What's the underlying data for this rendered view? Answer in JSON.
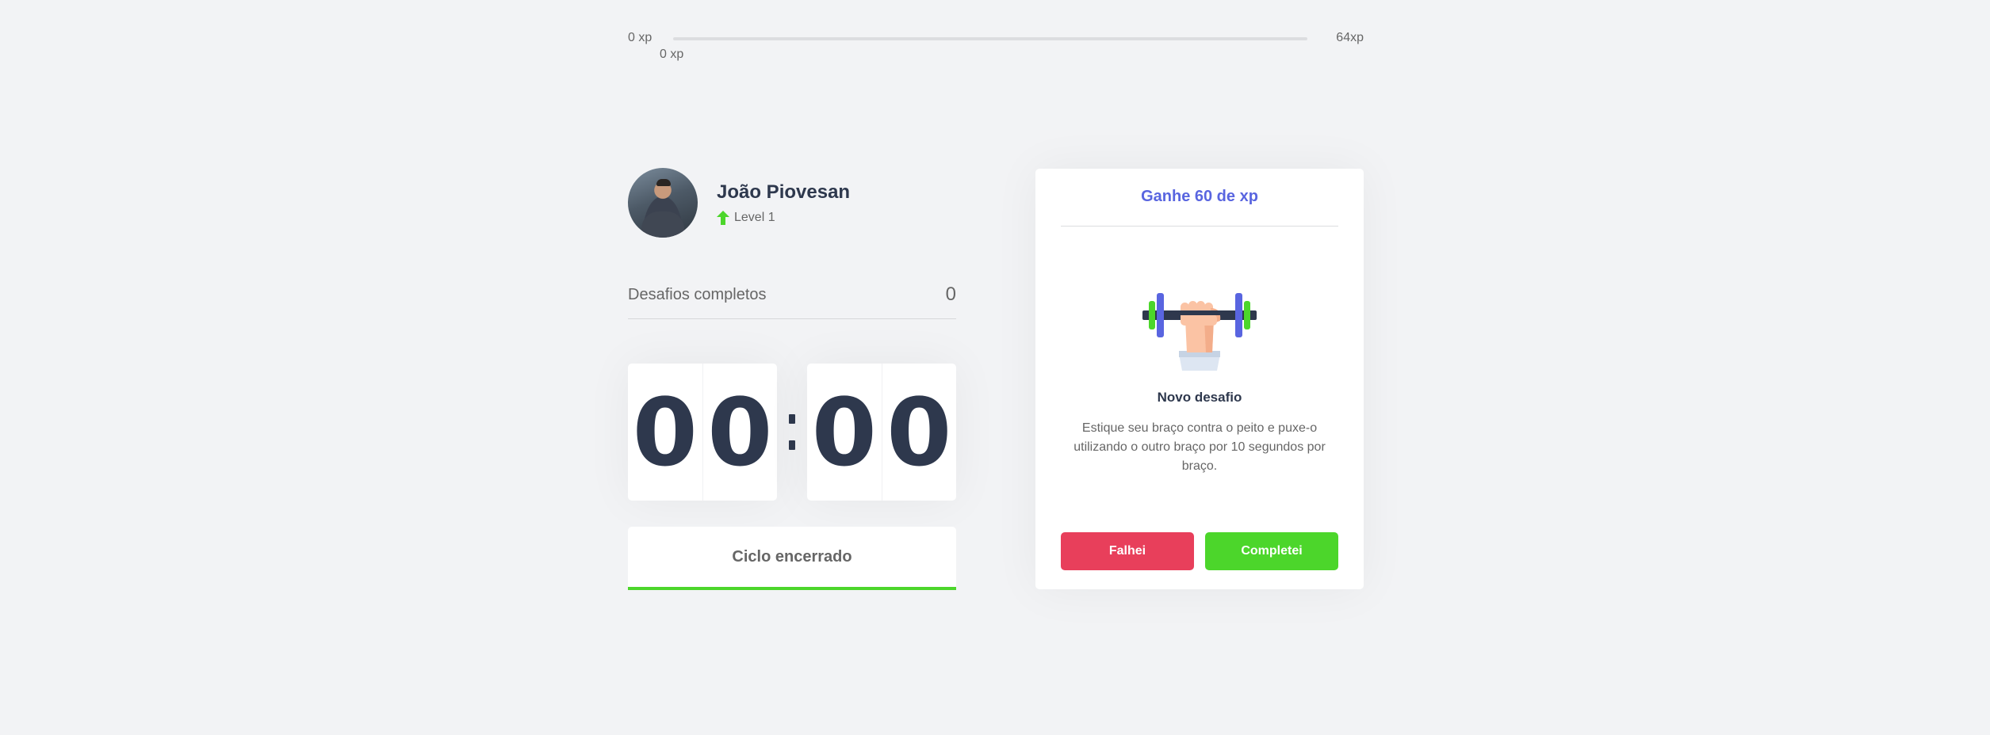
{
  "xp": {
    "min_label": "0 xp",
    "max_label": "64xp",
    "current_label": "0 xp",
    "progress_fraction": 0
  },
  "profile": {
    "name": "João Piovesan",
    "level_label": "Level 1",
    "level_icon": "level-up-arrow-icon"
  },
  "completed": {
    "label": "Desafios completos",
    "count": "0"
  },
  "countdown": {
    "minute_left": "0",
    "minute_right": "0",
    "second_left": "0",
    "second_right": "0"
  },
  "cycle_button": {
    "label": "Ciclo encerrado"
  },
  "challenge": {
    "title": "Ganhe 60 de xp",
    "icon": "dumbbell-arm-icon",
    "subtitle": "Novo desafio",
    "description": "Estique seu braço contra o peito e puxe-o utilizando o outro braço por 10 segundos por braço.",
    "fail_label": "Falhei",
    "complete_label": "Completei"
  },
  "colors": {
    "background": "#f2f3f5",
    "title": "#2e384d",
    "text": "#666666",
    "blue": "#5965e0",
    "green": "#4cd62b",
    "red": "#e83f5b"
  }
}
